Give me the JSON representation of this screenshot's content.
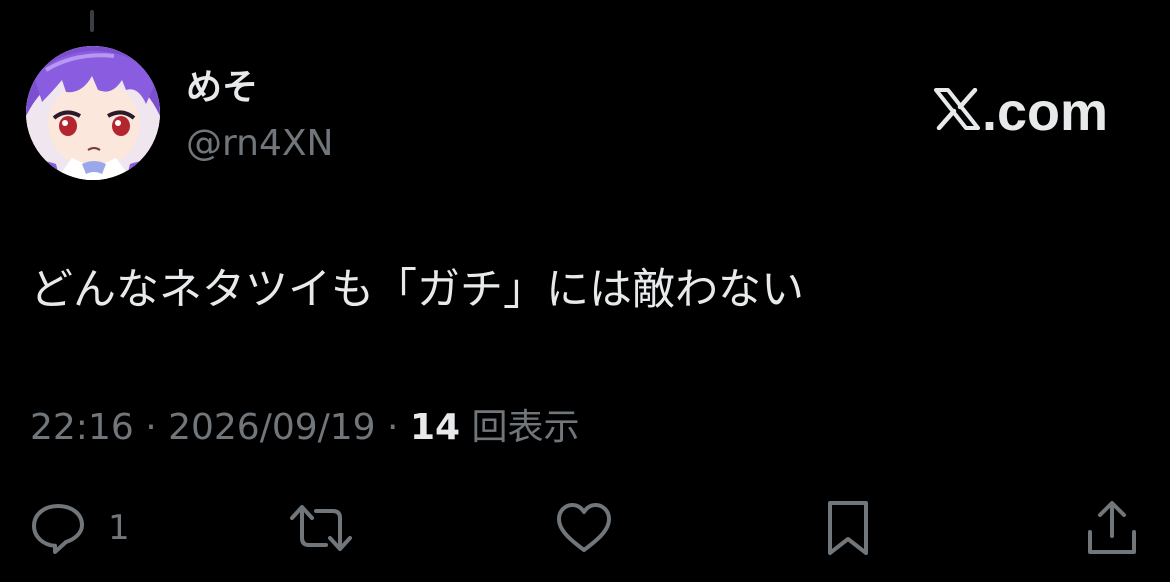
{
  "tweet": {
    "author": {
      "display_name": "めそ",
      "handle": "@rn4XN"
    },
    "brand": {
      "domain_suffix": ".com"
    },
    "text": "どんなネタツイも「ガチ」には敵わない",
    "meta": {
      "time": "22:16",
      "separator": " · ",
      "date": "2026/09/19",
      "views_count": "14",
      "views_label": " 回表示"
    },
    "actions": {
      "reply_count": "1"
    }
  },
  "colors": {
    "background": "#000000",
    "primary_text": "#e7e9ea",
    "secondary_text": "#71767b",
    "thread_line": "#3a3d41"
  },
  "icons": {
    "brand": "x-logo-icon",
    "reply": "reply-icon",
    "repost": "repost-icon",
    "like": "like-icon",
    "bookmark": "bookmark-icon",
    "share": "share-icon"
  }
}
